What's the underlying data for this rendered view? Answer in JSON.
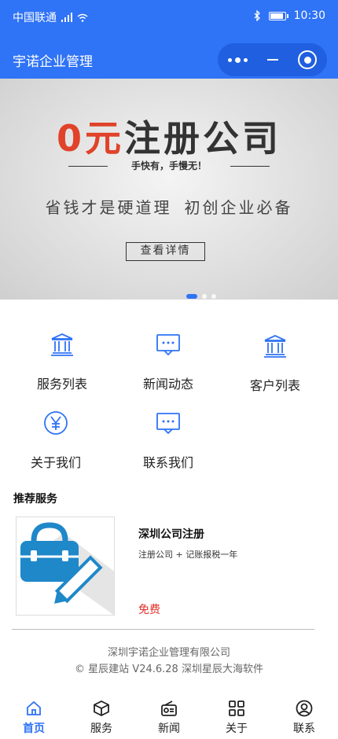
{
  "status_bar": {
    "carrier": "中国联通",
    "time": "10:30"
  },
  "header": {
    "title": "宇诺企业管理"
  },
  "banner": {
    "headline_prefix": "0元",
    "headline_main": "注册公司",
    "slogan": "手快有，手慢无！",
    "tagline_left": "省钱才是硬道理",
    "tagline_right": "初创企业必备",
    "button": "查看详情",
    "slides_total": 3,
    "slide_active": 1
  },
  "menu": [
    {
      "label": "服务列表",
      "icon": "bank-icon"
    },
    {
      "label": "新闻动态",
      "icon": "chat-icon"
    },
    {
      "label": "客户列表",
      "icon": "bank-icon"
    },
    {
      "label": "关于我们",
      "icon": "yen-icon"
    },
    {
      "label": "联系我们",
      "icon": "chat-icon"
    }
  ],
  "recommend": {
    "title": "推荐服务",
    "items": [
      {
        "title": "深圳公司注册",
        "desc": "注册公司 + 记账报税一年",
        "price": "免费",
        "image": "briefcase-pencil-icon"
      }
    ]
  },
  "footer": {
    "company": "深圳宇诺企业管理有限公司",
    "copyright": "© 星辰建站 V24.6.28 深圳星辰大海软件"
  },
  "tabs": [
    {
      "label": "首页",
      "icon": "home-icon",
      "active": true
    },
    {
      "label": "服务",
      "icon": "box-icon",
      "active": false
    },
    {
      "label": "新闻",
      "icon": "radio-icon",
      "active": false
    },
    {
      "label": "关于",
      "icon": "grid-icon",
      "active": false
    },
    {
      "label": "联系",
      "icon": "user-circle-icon",
      "active": false
    }
  ],
  "colors": {
    "primary": "#2f73f6",
    "price": "#e0302a",
    "banner_red": "#e0422a"
  }
}
